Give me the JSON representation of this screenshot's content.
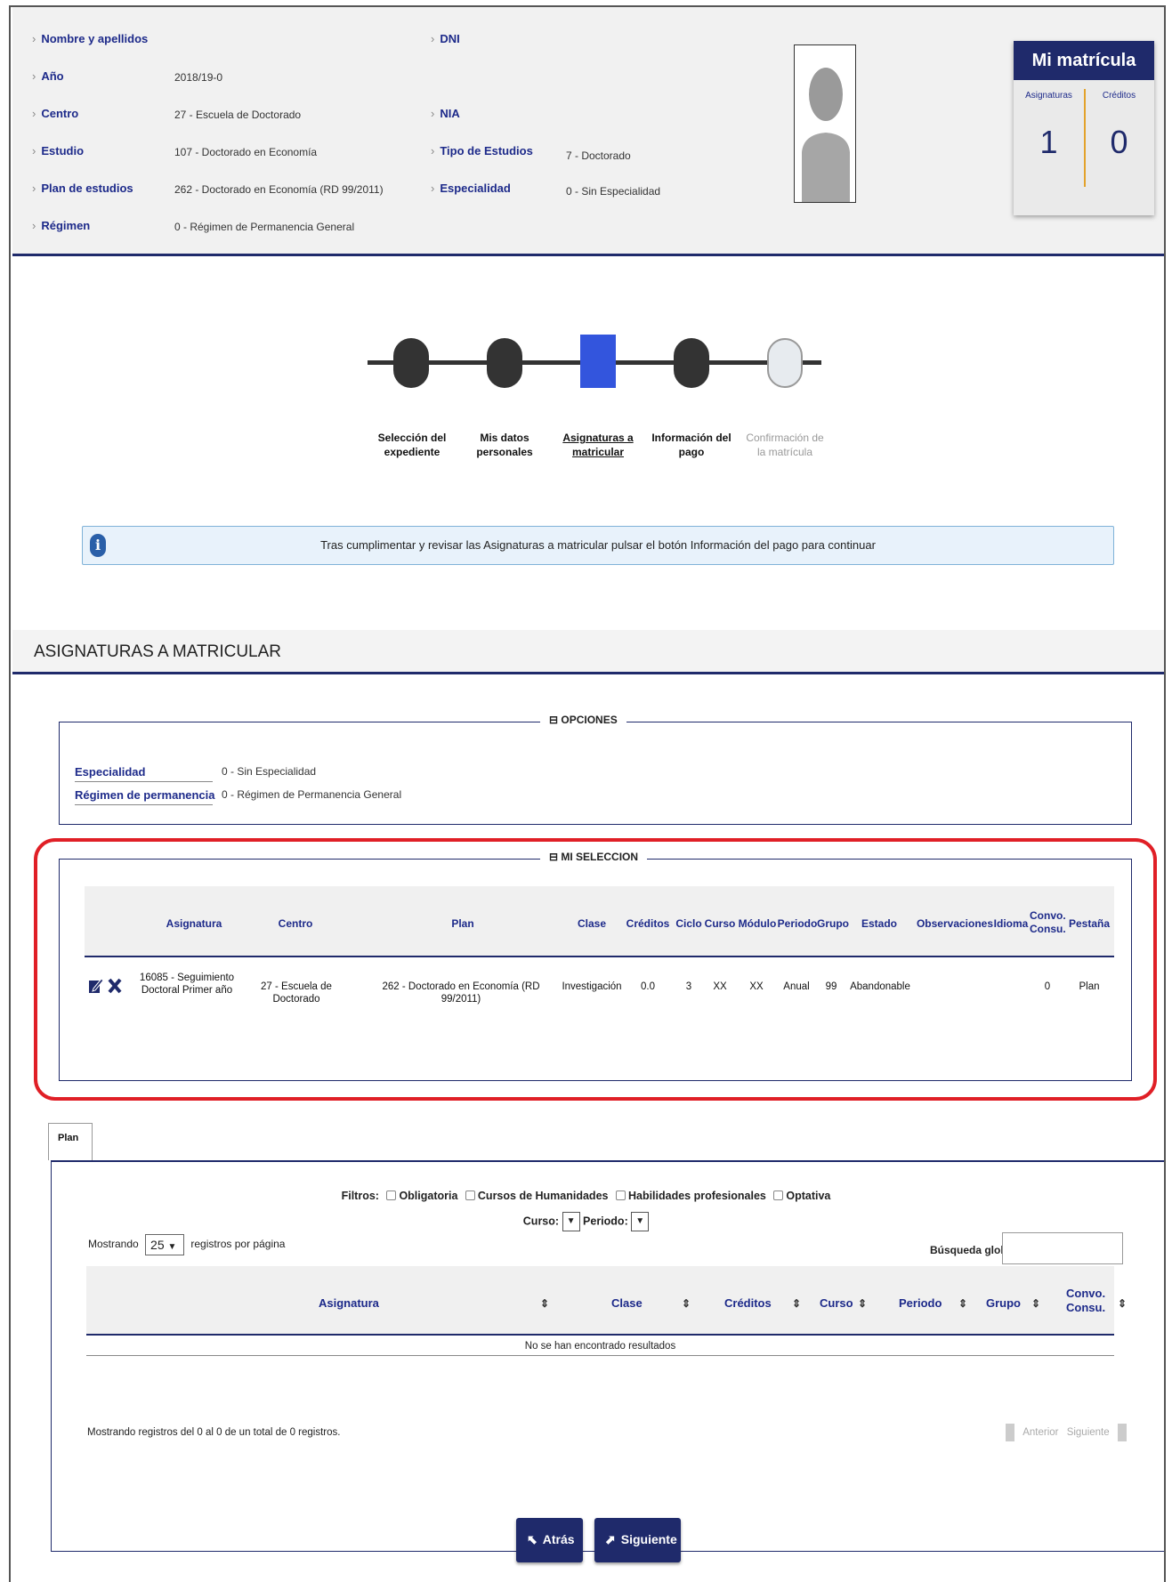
{
  "header": {
    "fields_left": [
      {
        "label": "Nombre y apellidos",
        "value": ""
      },
      {
        "label": "Año",
        "value": "2018/19-0"
      },
      {
        "label": "Centro",
        "value": "27 - Escuela de Doctorado"
      },
      {
        "label": "Estudio",
        "value": "107 - Doctorado en Economía"
      },
      {
        "label": "Plan de estudios",
        "value": "262 - Doctorado en Economía (RD 99/2011)"
      },
      {
        "label": "Régimen",
        "value": "0 - Régimen de Permanencia General"
      }
    ],
    "fields_right": [
      {
        "label": "DNI",
        "value": ""
      },
      {
        "label": "NIA",
        "value": ""
      },
      {
        "label": "Tipo de Estudios",
        "value": "7 - Doctorado"
      },
      {
        "label": "Especialidad",
        "value": "0 - Sin Especialidad"
      }
    ],
    "mi_matricula": {
      "title": "Mi matrícula",
      "asignaturas_label": "Asignaturas",
      "creditos_label": "Créditos",
      "asignaturas_value": "1",
      "creditos_value": "0"
    }
  },
  "steps": [
    {
      "line1": "Selección del",
      "line2": "expediente"
    },
    {
      "line1": "Mis datos",
      "line2": "personales"
    },
    {
      "line1": "Asignaturas a",
      "line2": "matricular"
    },
    {
      "line1": "Información del",
      "line2": "pago"
    },
    {
      "line1": "Confirmación de",
      "line2": "la matrícula"
    }
  ],
  "info_message": "Tras cumplimentar y revisar las Asignaturas a matricular pulsar el botón Información del pago para continuar",
  "section_title": "ASIGNATURAS A MATRICULAR",
  "opciones": {
    "legend": "⊟ OPCIONES",
    "especialidad_label": "Especialidad",
    "especialidad_value": "0 - Sin Especialidad",
    "regimen_label": "Régimen de permanencia",
    "regimen_value": "0 - Régimen de Permanencia General"
  },
  "seleccion": {
    "legend": "⊟ MI SELECCION",
    "headers": {
      "asignatura": "Asignatura",
      "centro": "Centro",
      "plan": "Plan",
      "clase": "Clase",
      "creditos": "Créditos",
      "ciclo": "Ciclo",
      "curso": "Curso",
      "modulo": "Módulo",
      "periodo": "Periodo",
      "grupo": "Grupo",
      "estado": "Estado",
      "observaciones": "Observaciones",
      "idioma": "Idioma",
      "convo1": "Convo.",
      "convo2": "Consu.",
      "pestana": "Pestaña"
    },
    "row": {
      "asignatura1": "16085 - Seguimiento",
      "asignatura2": "Doctoral Primer año",
      "centro": "27 - Escuela de Doctorado",
      "plan": "262 - Doctorado en Economía (RD 99/2011)",
      "clase": "Investigación",
      "creditos": "0.0",
      "ciclo": "3",
      "curso": "XX",
      "modulo": "XX",
      "periodo": "Anual",
      "grupo": "99",
      "estado": "Abandonable",
      "convo": "0",
      "pestana": "Plan"
    }
  },
  "plan_tab": {
    "tab_label": "Plan",
    "filtros_label": "Filtros:",
    "filters": [
      "Obligatoria",
      "Cursos de Humanidades",
      "Habilidades profesionales",
      "Optativa"
    ],
    "curso_label": "Curso:",
    "periodo_label": "Periodo:",
    "mostrando_label": "Mostrando",
    "per_page": "25",
    "registros_label": "registros por página",
    "busqueda_label": "Búsqueda global",
    "headers": {
      "asignatura": "Asignatura",
      "clase": "Clase",
      "creditos": "Créditos",
      "curso": "Curso",
      "periodo": "Periodo",
      "grupo": "Grupo",
      "convo1": "Convo.",
      "convo2": "Consu."
    },
    "empty_message": "No se han encontrado resultados",
    "footer_info": "Mostrando registros del 0 al 0 de un total de 0 registros.",
    "prev_label": "Anterior",
    "next_label": "Siguiente"
  },
  "buttons": {
    "back": "Atrás",
    "next": "Siguiente"
  },
  "colors": {
    "navy": "#1f2a6b",
    "accent_blue": "#3355dd",
    "highlight_red": "#e01f26",
    "divider_orange": "#e3a22a"
  }
}
